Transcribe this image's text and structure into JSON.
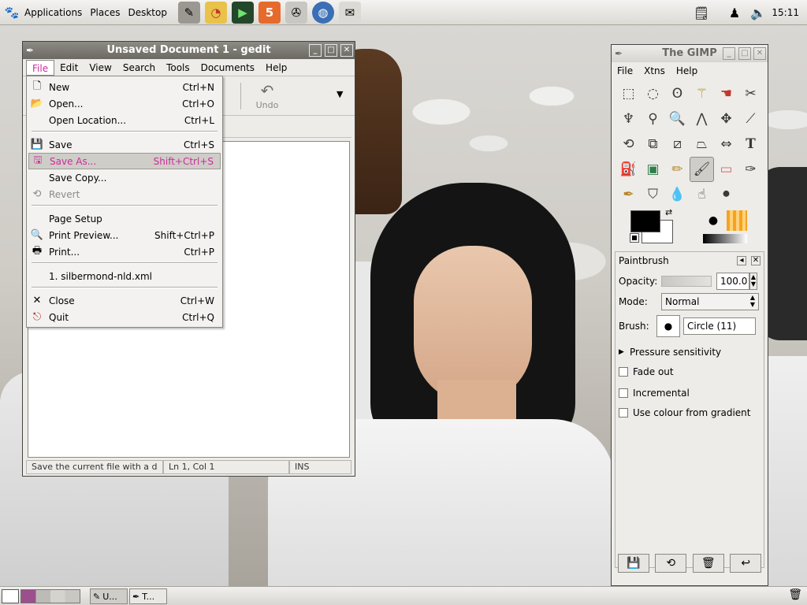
{
  "panel": {
    "menus": [
      "Applications",
      "Places",
      "Desktop"
    ],
    "launchers": [
      "text-editor-icon",
      "chart-icon",
      "terminal-icon",
      "html5-icon",
      "film-reel-icon",
      "globe-icon",
      "mail-icon"
    ],
    "clock": "15:11"
  },
  "gedit": {
    "title": "Unsaved Document 1 - gedit",
    "menus": [
      "File",
      "Edit",
      "View",
      "Search",
      "Tools",
      "Documents",
      "Help"
    ],
    "toolbar": {
      "partial_label": "t",
      "undo_label": "Undo"
    },
    "status": {
      "message": "Save the current file with a d",
      "position": "Ln 1, Col 1",
      "mode": "INS"
    }
  },
  "file_menu": {
    "items": [
      {
        "label": "New",
        "accel": "Ctrl+N",
        "icon": "new-document-icon"
      },
      {
        "label": "Open...",
        "accel": "Ctrl+O",
        "icon": "folder-open-icon"
      },
      {
        "label": "Open Location...",
        "accel": "Ctrl+L",
        "icon": ""
      },
      {
        "label": "Save",
        "accel": "Ctrl+S",
        "icon": "save-icon"
      },
      {
        "label": "Save As...",
        "accel": "Shift+Ctrl+S",
        "icon": "save-as-icon",
        "selected": true
      },
      {
        "label": "Save Copy...",
        "accel": "",
        "icon": ""
      },
      {
        "label": "Revert",
        "accel": "",
        "icon": "revert-icon",
        "disabled": true
      },
      {
        "label": "Page Setup",
        "accel": "",
        "icon": ""
      },
      {
        "label": "Print Preview...",
        "accel": "Shift+Ctrl+P",
        "icon": "print-preview-icon"
      },
      {
        "label": "Print...",
        "accel": "Ctrl+P",
        "icon": "printer-icon"
      },
      {
        "label": "1. silbermond-nld.xml",
        "accel": "",
        "icon": ""
      },
      {
        "label": "Close",
        "accel": "Ctrl+W",
        "icon": "close-icon"
      },
      {
        "label": "Quit",
        "accel": "Ctrl+Q",
        "icon": "quit-icon"
      }
    ]
  },
  "gimp": {
    "title": "The GIMP",
    "menus": [
      "File",
      "Xtns",
      "Help"
    ],
    "tool_options": {
      "heading": "Paintbrush",
      "opacity_label": "Opacity:",
      "opacity_value": "100.0",
      "mode_label": "Mode:",
      "mode_value": "Normal",
      "brush_label": "Brush:",
      "brush_value": "Circle (11)",
      "pressure_label": "Pressure sensitivity",
      "fade_label": "Fade out",
      "incremental_label": "Incremental",
      "gradient_label": "Use colour from gradient"
    }
  },
  "taskbar": {
    "items": [
      {
        "label": "U...",
        "icon": "text-editor-icon"
      },
      {
        "label": "T...",
        "icon": "gimp-icon"
      }
    ]
  },
  "colors": {
    "foreground": "#000000",
    "background": "#ffffff",
    "selection": "#cf2b9a"
  }
}
